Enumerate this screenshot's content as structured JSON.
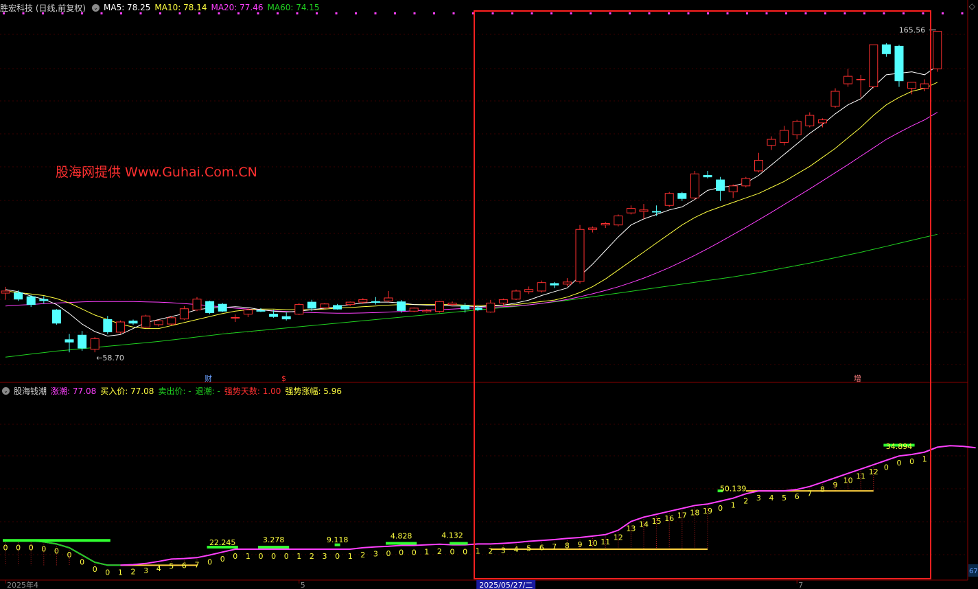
{
  "header": {
    "stock_label": "胜宏科技 (日线,前复权)",
    "ma5": "MA5: 78.25",
    "ma10": "MA10: 78.14",
    "ma20": "MA20: 77.46",
    "ma60": "MA60: 74.15"
  },
  "watermark": "股海网提供 Www.Guhai.Com.CN",
  "indicator_header": {
    "name": "股海钱潮",
    "zhangchao": "涨潮: 77.08",
    "buy_price": "买入价: 77.08",
    "sell_price": "卖出价: -",
    "tuichao": "退潮: -",
    "strong_days": "强势天数: 1.00",
    "strong_gain": "强势涨幅: 5.96"
  },
  "colors": {
    "up": "#ff3030",
    "down": "#54ffff",
    "ma5": "#ffffff",
    "ma10": "#ffff40",
    "ma20": "#ff40ff",
    "ma60": "#20d020",
    "highlight_box": "#ff2020"
  },
  "chart_data": {
    "type": "candlestick",
    "y_range": [
      56,
      168
    ],
    "max_label": "165.56",
    "min_label": "58.70",
    "candles": [
      {
        "o": 78.4,
        "h": 80.5,
        "l": 76.2,
        "c": 79.1
      },
      {
        "o": 78.5,
        "h": 79.3,
        "l": 75.8,
        "c": 76.4
      },
      {
        "o": 77.2,
        "h": 77.8,
        "l": 73.8,
        "c": 74.6
      },
      {
        "o": 76.3,
        "h": 77.4,
        "l": 74.9,
        "c": 75.9
      },
      {
        "o": 72.8,
        "h": 73.1,
        "l": 67.9,
        "c": 68.4
      },
      {
        "o": 62.9,
        "h": 64.8,
        "l": 58.7,
        "c": 62.1
      },
      {
        "o": 64.4,
        "h": 65.8,
        "l": 59.2,
        "c": 60.1
      },
      {
        "o": 59.7,
        "h": 63.8,
        "l": 58.7,
        "c": 63.2
      },
      {
        "o": 69.6,
        "h": 70.8,
        "l": 64.8,
        "c": 65.5
      },
      {
        "o": 65.4,
        "h": 69.3,
        "l": 64.9,
        "c": 68.8
      },
      {
        "o": 69.1,
        "h": 69.6,
        "l": 67.9,
        "c": 68.4
      },
      {
        "o": 67.1,
        "h": 71.2,
        "l": 66.9,
        "c": 70.8
      },
      {
        "o": 67.9,
        "h": 69.6,
        "l": 67.3,
        "c": 69.2
      },
      {
        "o": 68.1,
        "h": 70.8,
        "l": 67.7,
        "c": 70.2
      },
      {
        "o": 69.8,
        "h": 74.1,
        "l": 69.4,
        "c": 73.2
      },
      {
        "o": 72.8,
        "h": 77.1,
        "l": 72.4,
        "c": 76.4
      },
      {
        "o": 75.6,
        "h": 75.9,
        "l": 71.4,
        "c": 71.9
      },
      {
        "o": 74.7,
        "h": 75.1,
        "l": 72.1,
        "c": 72.4
      },
      {
        "o": 70.1,
        "h": 71.3,
        "l": 68.8,
        "c": 70.3
      },
      {
        "o": 71.4,
        "h": 73.3,
        "l": 70.4,
        "c": 72.8
      },
      {
        "o": 72.6,
        "h": 73.4,
        "l": 72.1,
        "c": 72.5
      },
      {
        "o": 71.4,
        "h": 72.8,
        "l": 70.2,
        "c": 70.6
      },
      {
        "o": 70.6,
        "h": 71.9,
        "l": 69.3,
        "c": 69.8
      },
      {
        "o": 71.4,
        "h": 75.1,
        "l": 71.1,
        "c": 74.6
      },
      {
        "o": 75.4,
        "h": 76.2,
        "l": 72.4,
        "c": 73.4
      },
      {
        "o": 73.5,
        "h": 75.1,
        "l": 73.1,
        "c": 74.8
      },
      {
        "o": 74.3,
        "h": 74.8,
        "l": 72.9,
        "c": 73.1
      },
      {
        "o": 74.6,
        "h": 75.6,
        "l": 74.1,
        "c": 75.4
      },
      {
        "o": 75.4,
        "h": 76.7,
        "l": 74.8,
        "c": 76.2
      },
      {
        "o": 75.6,
        "h": 77.1,
        "l": 74.6,
        "c": 75.3
      },
      {
        "o": 75.8,
        "h": 79.1,
        "l": 75.4,
        "c": 76.8
      },
      {
        "o": 75.5,
        "h": 76.1,
        "l": 71.9,
        "c": 72.6
      },
      {
        "o": 72.4,
        "h": 73.6,
        "l": 72.1,
        "c": 73.4
      },
      {
        "o": 72.2,
        "h": 73.1,
        "l": 71.9,
        "c": 72.6
      },
      {
        "o": 72.3,
        "h": 75.8,
        "l": 71.9,
        "c": 75.6
      },
      {
        "o": 74.6,
        "h": 75.6,
        "l": 74.1,
        "c": 75.1
      },
      {
        "o": 74.2,
        "h": 75.1,
        "l": 71.9,
        "c": 73.1
      },
      {
        "o": 73.5,
        "h": 74.1,
        "l": 72.4,
        "c": 72.9
      },
      {
        "o": 72.1,
        "h": 76.1,
        "l": 71.9,
        "c": 75.1
      },
      {
        "o": 75.1,
        "h": 76.6,
        "l": 73.9,
        "c": 76.2
      },
      {
        "o": 76.4,
        "h": 79.6,
        "l": 76.1,
        "c": 79.1
      },
      {
        "o": 78.9,
        "h": 80.6,
        "l": 78.1,
        "c": 79.6
      },
      {
        "o": 79.1,
        "h": 82.6,
        "l": 78.6,
        "c": 81.9
      },
      {
        "o": 81.6,
        "h": 82.1,
        "l": 80.1,
        "c": 81.1
      },
      {
        "o": 81.4,
        "h": 83.4,
        "l": 80.6,
        "c": 82.1
      },
      {
        "o": 82.3,
        "h": 101.1,
        "l": 81.6,
        "c": 99.6
      },
      {
        "o": 99.6,
        "h": 100.6,
        "l": 98.6,
        "c": 100.1
      },
      {
        "o": 101.1,
        "h": 102.1,
        "l": 100.1,
        "c": 101.6
      },
      {
        "o": 101.1,
        "h": 104.6,
        "l": 100.6,
        "c": 104.1
      },
      {
        "o": 105.1,
        "h": 107.6,
        "l": 104.6,
        "c": 106.6
      },
      {
        "o": 105.6,
        "h": 108.1,
        "l": 103.1,
        "c": 106.1
      },
      {
        "o": 105.6,
        "h": 107.6,
        "l": 104.1,
        "c": 105.4
      },
      {
        "o": 107.6,
        "h": 112.1,
        "l": 107.1,
        "c": 111.6
      },
      {
        "o": 111.6,
        "h": 112.1,
        "l": 109.1,
        "c": 109.9
      },
      {
        "o": 110.1,
        "h": 119.1,
        "l": 109.6,
        "c": 118.1
      },
      {
        "o": 117.6,
        "h": 119.1,
        "l": 116.6,
        "c": 117.1
      },
      {
        "o": 116.1,
        "h": 117.1,
        "l": 109.1,
        "c": 112.6
      },
      {
        "o": 112.1,
        "h": 114.6,
        "l": 110.1,
        "c": 114.1
      },
      {
        "o": 114.1,
        "h": 117.1,
        "l": 113.6,
        "c": 116.6
      },
      {
        "o": 119.1,
        "h": 125.1,
        "l": 118.6,
        "c": 122.6
      },
      {
        "o": 127.6,
        "h": 130.6,
        "l": 126.1,
        "c": 129.6
      },
      {
        "o": 128.6,
        "h": 134.1,
        "l": 127.6,
        "c": 132.6
      },
      {
        "o": 131.1,
        "h": 136.1,
        "l": 129.6,
        "c": 135.6
      },
      {
        "o": 134.1,
        "h": 138.6,
        "l": 133.6,
        "c": 137.6
      },
      {
        "o": 135.1,
        "h": 136.6,
        "l": 133.6,
        "c": 136.1
      },
      {
        "o": 140.6,
        "h": 146.6,
        "l": 140.1,
        "c": 145.6
      },
      {
        "o": 148.1,
        "h": 153.1,
        "l": 147.1,
        "c": 150.6
      },
      {
        "o": 149.6,
        "h": 151.1,
        "l": 143.6,
        "c": 149.6
      },
      {
        "o": 147.1,
        "h": 161.1,
        "l": 146.6,
        "c": 161.1
      },
      {
        "o": 161.1,
        "h": 161.6,
        "l": 157.1,
        "c": 158.1
      },
      {
        "o": 160.6,
        "h": 161.1,
        "l": 147.1,
        "c": 149.1
      },
      {
        "o": 146.6,
        "h": 148.6,
        "l": 144.6,
        "c": 148.6
      },
      {
        "o": 146.6,
        "h": 149.6,
        "l": 145.6,
        "c": 148.1
      },
      {
        "o": 153.1,
        "h": 165.56,
        "l": 152.1,
        "c": 165.56
      }
    ],
    "ma5": [
      79.6,
      78.9,
      77.4,
      76.4,
      74.6,
      71.6,
      68.1,
      65.6,
      64.1,
      64.6,
      66.6,
      68.6,
      69.6,
      70.6,
      71.6,
      72.9,
      73.4,
      73.6,
      73.9,
      73.6,
      72.9,
      72.4,
      72.1,
      72.4,
      72.9,
      73.4,
      73.9,
      74.6,
      75.1,
      75.4,
      75.4,
      75.1,
      74.6,
      74.4,
      74.4,
      74.1,
      74.1,
      73.9,
      74.1,
      74.4,
      75.1,
      76.1,
      77.6,
      78.9,
      80.1,
      84.1,
      88.1,
      92.6,
      97.1,
      101.1,
      103.1,
      104.6,
      106.1,
      107.1,
      109.6,
      112.6,
      113.6,
      114.1,
      115.1,
      117.6,
      121.1,
      124.6,
      128.1,
      131.6,
      134.6,
      138.1,
      141.1,
      143.1,
      147.1,
      151.1,
      151.6,
      152.1,
      151.1,
      154.1
    ],
    "ma10": [
      79.1,
      78.6,
      78.1,
      77.6,
      76.6,
      75.1,
      73.1,
      71.1,
      69.6,
      68.1,
      67.1,
      66.6,
      66.6,
      67.6,
      68.6,
      69.6,
      70.6,
      71.6,
      72.4,
      72.9,
      73.1,
      73.1,
      72.9,
      72.9,
      72.9,
      73.1,
      73.4,
      73.6,
      73.9,
      74.1,
      74.4,
      74.6,
      74.6,
      74.6,
      74.6,
      74.6,
      74.4,
      74.4,
      74.4,
      74.4,
      74.6,
      75.1,
      75.6,
      76.1,
      77.1,
      78.6,
      80.6,
      83.1,
      86.1,
      89.1,
      92.1,
      95.1,
      98.1,
      101.1,
      103.6,
      105.6,
      107.1,
      108.6,
      110.1,
      111.6,
      113.6,
      115.6,
      118.1,
      120.6,
      123.6,
      126.6,
      130.1,
      133.6,
      137.6,
      141.1,
      143.6,
      145.6,
      146.6,
      148.6
    ],
    "ma20": [
      74.1,
      74.4,
      74.6,
      74.9,
      75.1,
      75.3,
      75.5,
      75.6,
      75.6,
      75.6,
      75.6,
      75.5,
      75.4,
      75.2,
      74.9,
      74.6,
      74.2,
      73.8,
      73.4,
      73.1,
      72.8,
      72.5,
      72.3,
      72.1,
      71.9,
      71.8,
      71.7,
      71.7,
      71.8,
      71.9,
      72.1,
      72.3,
      72.5,
      72.7,
      72.9,
      73.1,
      73.3,
      73.5,
      73.7,
      73.9,
      74.1,
      74.5,
      75.0,
      75.6,
      76.3,
      77.2,
      78.2,
      79.3,
      80.5,
      81.9,
      83.4,
      85.1,
      86.9,
      88.9,
      91.0,
      93.2,
      95.5,
      97.9,
      100.3,
      102.8,
      105.3,
      107.9,
      110.5,
      113.1,
      115.8,
      118.5,
      121.2,
      124.0,
      126.8,
      129.6,
      131.9,
      134.1,
      136.1,
      138.6
    ],
    "ma60": [
      57.1,
      57.6,
      58.1,
      58.6,
      59.1,
      59.5,
      59.9,
      60.3,
      60.7,
      61.1,
      61.5,
      61.9,
      62.3,
      62.8,
      63.3,
      63.8,
      64.3,
      64.8,
      65.2,
      65.6,
      66.0,
      66.4,
      66.8,
      67.2,
      67.6,
      68.0,
      68.4,
      68.8,
      69.2,
      69.6,
      70.0,
      70.4,
      70.8,
      71.2,
      71.6,
      72.0,
      72.4,
      72.8,
      73.2,
      73.6,
      74.0,
      74.5,
      75.0,
      75.5,
      76.0,
      76.6,
      77.2,
      77.8,
      78.4,
      79.0,
      79.6,
      80.2,
      80.8,
      81.4,
      82.0,
      82.6,
      83.2,
      83.8,
      84.5,
      85.2,
      86.0,
      86.8,
      87.6,
      88.4,
      89.3,
      90.2,
      91.1,
      92.0,
      93.0,
      94.0,
      95.0,
      96.0,
      97.0,
      98.0
    ]
  },
  "indicator": {
    "y_range": [
      -1,
      52
    ],
    "line": [
      12.6,
      12.6,
      12.6,
      12.1,
      11.4,
      10.1,
      7.6,
      5.1,
      4.1,
      4.1,
      4.3,
      4.7,
      5.4,
      6.2,
      6.4,
      6.7,
      7.6,
      8.6,
      9.6,
      9.6,
      9.6,
      9.6,
      9.6,
      9.6,
      9.6,
      9.6,
      9.6,
      9.6,
      10.1,
      10.4,
      10.6,
      10.9,
      10.9,
      11.1,
      11.3,
      11.1,
      11.1,
      11.4,
      11.4,
      11.6,
      11.9,
      12.3,
      12.6,
      12.9,
      13.3,
      13.6,
      14.1,
      14.6,
      16.1,
      19.1,
      20.6,
      21.6,
      22.6,
      23.6,
      24.6,
      25.1,
      26.1,
      27.1,
      28.6,
      29.6,
      29.6,
      29.6,
      30.1,
      31.1,
      32.6,
      34.1,
      35.6,
      37.1,
      38.6,
      40.1,
      41.6,
      42.1,
      42.9,
      44.6,
      45.1,
      44.9,
      44.4
    ],
    "baselines": [
      {
        "from": 9,
        "to": 15,
        "value": 4.1
      },
      {
        "from": 38,
        "to": 55,
        "value": 9.6
      },
      {
        "from": 58,
        "to": 68,
        "value": 29.6
      }
    ],
    "green_bars": [
      {
        "from": 0,
        "to": 8,
        "value": 12.6
      },
      {
        "from": 16,
        "to": 18,
        "value": 10.3
      },
      {
        "from": 20,
        "to": 22,
        "value": 10.3
      },
      {
        "from": 26,
        "to": 26,
        "value": 11.1
      },
      {
        "from": 30,
        "to": 32,
        "value": 11.6
      },
      {
        "from": 35,
        "to": 36,
        "value": 11.6
      },
      {
        "from": 56,
        "to": 56,
        "value": 29.6
      },
      {
        "from": 69,
        "to": 71,
        "value": 45.3
      }
    ],
    "counts": [
      {
        "i": 0,
        "t": "0"
      },
      {
        "i": 1,
        "t": "0"
      },
      {
        "i": 2,
        "t": "0"
      },
      {
        "i": 3,
        "t": "0"
      },
      {
        "i": 4,
        "t": "0"
      },
      {
        "i": 5,
        "t": "0"
      },
      {
        "i": 6,
        "t": "0"
      },
      {
        "i": 7,
        "t": "0"
      },
      {
        "i": 8,
        "t": "0"
      },
      {
        "i": 9,
        "t": "1"
      },
      {
        "i": 10,
        "t": "2"
      },
      {
        "i": 11,
        "t": "3"
      },
      {
        "i": 12,
        "t": "4"
      },
      {
        "i": 13,
        "t": "5"
      },
      {
        "i": 14,
        "t": "6"
      },
      {
        "i": 15,
        "t": "7"
      },
      {
        "i": 16,
        "t": "0"
      },
      {
        "i": 17,
        "t": "0"
      },
      {
        "i": 18,
        "t": "0"
      },
      {
        "i": 19,
        "t": "1"
      },
      {
        "i": 20,
        "t": "0"
      },
      {
        "i": 21,
        "t": "0"
      },
      {
        "i": 22,
        "t": "0"
      },
      {
        "i": 23,
        "t": "1"
      },
      {
        "i": 24,
        "t": "2"
      },
      {
        "i": 25,
        "t": "3"
      },
      {
        "i": 26,
        "t": "0"
      },
      {
        "i": 27,
        "t": "1"
      },
      {
        "i": 28,
        "t": "2"
      },
      {
        "i": 29,
        "t": "3"
      },
      {
        "i": 30,
        "t": "0"
      },
      {
        "i": 31,
        "t": "0"
      },
      {
        "i": 32,
        "t": "0"
      },
      {
        "i": 33,
        "t": "1"
      },
      {
        "i": 34,
        "t": "2"
      },
      {
        "i": 35,
        "t": "0"
      },
      {
        "i": 36,
        "t": "0"
      },
      {
        "i": 37,
        "t": "1"
      },
      {
        "i": 38,
        "t": "2"
      },
      {
        "i": 39,
        "t": "3"
      },
      {
        "i": 40,
        "t": "4"
      },
      {
        "i": 41,
        "t": "5"
      },
      {
        "i": 42,
        "t": "6"
      },
      {
        "i": 43,
        "t": "7"
      },
      {
        "i": 44,
        "t": "8"
      },
      {
        "i": 45,
        "t": "9"
      },
      {
        "i": 46,
        "t": "10"
      },
      {
        "i": 47,
        "t": "11"
      },
      {
        "i": 48,
        "t": "12"
      },
      {
        "i": 49,
        "t": "13"
      },
      {
        "i": 50,
        "t": "14"
      },
      {
        "i": 51,
        "t": "15"
      },
      {
        "i": 52,
        "t": "16"
      },
      {
        "i": 53,
        "t": "17"
      },
      {
        "i": 54,
        "t": "18"
      },
      {
        "i": 55,
        "t": "19"
      },
      {
        "i": 56,
        "t": "0"
      },
      {
        "i": 57,
        "t": "1"
      },
      {
        "i": 58,
        "t": "2"
      },
      {
        "i": 59,
        "t": "3"
      },
      {
        "i": 60,
        "t": "4"
      },
      {
        "i": 61,
        "t": "5"
      },
      {
        "i": 62,
        "t": "6"
      },
      {
        "i": 63,
        "t": "7"
      },
      {
        "i": 64,
        "t": "8"
      },
      {
        "i": 65,
        "t": "9"
      },
      {
        "i": 66,
        "t": "10"
      },
      {
        "i": 67,
        "t": "11"
      },
      {
        "i": 68,
        "t": "12"
      },
      {
        "i": 69,
        "t": "0"
      },
      {
        "i": 70,
        "t": "0"
      },
      {
        "i": 71,
        "t": "0"
      },
      {
        "i": 72,
        "t": "1"
      }
    ],
    "value_labels": [
      {
        "i": 17,
        "t": "22.245"
      },
      {
        "i": 21,
        "t": "3.278"
      },
      {
        "i": 26,
        "t": "9.118"
      },
      {
        "i": 31,
        "t": "4.828"
      },
      {
        "i": 35,
        "t": "4.132"
      },
      {
        "i": 57,
        "t": "50.139"
      },
      {
        "i": 70,
        "t": "34.894"
      }
    ]
  },
  "markers": {
    "cai": "财",
    "dollar": "$",
    "zeng": "增"
  },
  "xaxis": {
    "labels": [
      {
        "i": 0,
        "t": "2025年4"
      },
      {
        "i": 23,
        "t": "5"
      },
      {
        "i": 37,
        "t": "2025/05/27/二"
      },
      {
        "i": 62,
        "t": "7"
      }
    ],
    "right_tag": "67"
  }
}
